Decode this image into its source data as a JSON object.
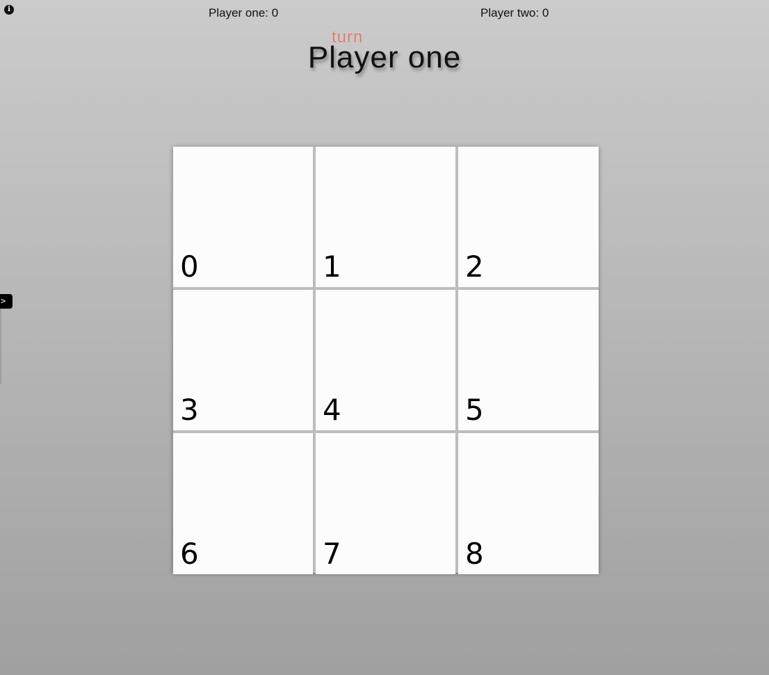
{
  "header": {
    "info_icon": "i",
    "player_one_label": "Player one:",
    "player_one_score": "0",
    "player_two_label": "Player two:",
    "player_two_score": "0",
    "turn_label": "turn",
    "current_player": "Player one"
  },
  "side_panel": {
    "toggle_label": ">"
  },
  "board": {
    "cells": [
      "0",
      "1",
      "2",
      "3",
      "4",
      "5",
      "6",
      "7",
      "8"
    ]
  },
  "colors": {
    "turn_label": "#e07a72",
    "board_lines": "#bdbdbd",
    "cell_background": "#fcfcfc"
  }
}
